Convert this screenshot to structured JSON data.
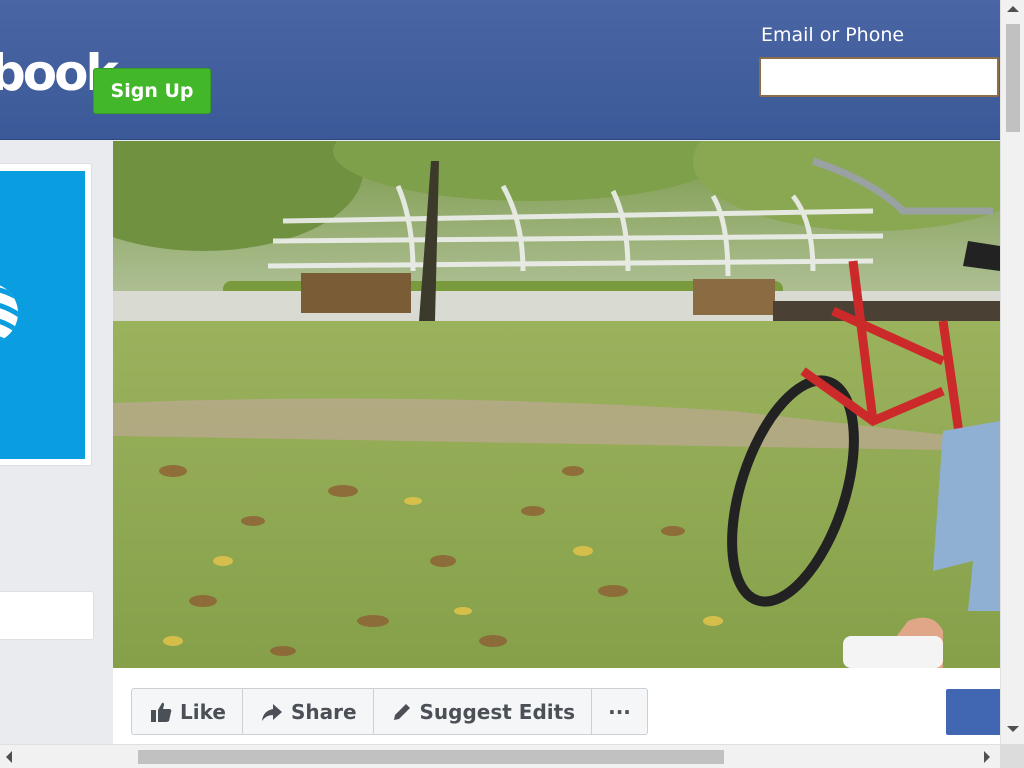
{
  "header": {
    "logo_text": "book",
    "signup_label": "Sign Up",
    "email_label": "Email or Phone",
    "email_value": ""
  },
  "actions": {
    "like": "Like",
    "share": "Share",
    "suggest": "Suggest Edits",
    "more": "···"
  },
  "icons": {
    "like": "thumbs-up-icon",
    "share": "share-arrow-icon",
    "suggest": "pencil-icon",
    "more": "ellipsis-icon",
    "profile": "att-globe-icon"
  },
  "colors": {
    "brand": "#3b5998",
    "signup": "#42b72a",
    "profile_bg": "#0a9de0"
  }
}
